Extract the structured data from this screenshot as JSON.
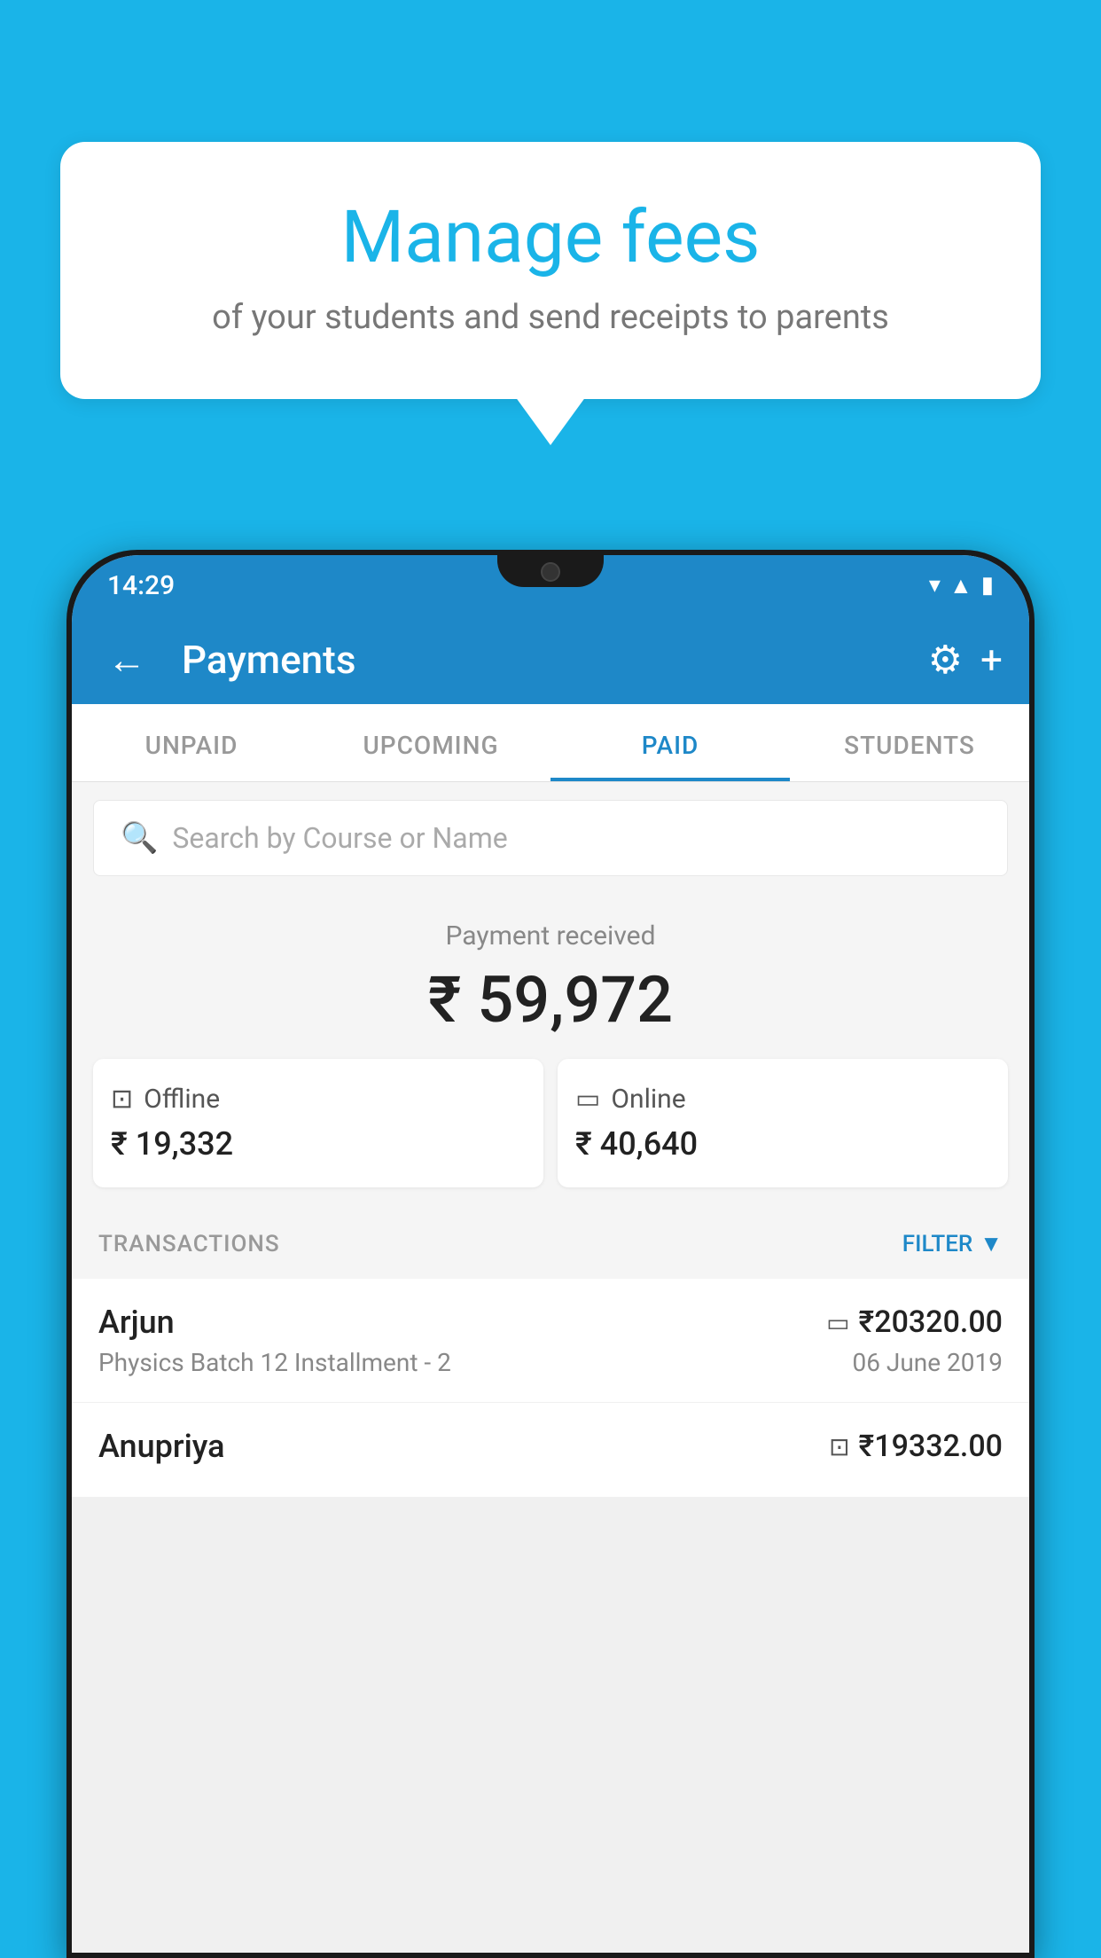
{
  "bubble": {
    "title": "Manage fees",
    "subtitle": "of your students and send receipts to parents"
  },
  "status_bar": {
    "time": "14:29"
  },
  "app_bar": {
    "title": "Payments",
    "back_label": "←",
    "gear_label": "⚙",
    "plus_label": "+"
  },
  "tabs": [
    {
      "label": "UNPAID",
      "active": false
    },
    {
      "label": "UPCOMING",
      "active": false
    },
    {
      "label": "PAID",
      "active": true
    },
    {
      "label": "STUDENTS",
      "active": false
    }
  ],
  "search": {
    "placeholder": "Search by Course or Name"
  },
  "payment_summary": {
    "label": "Payment received",
    "amount": "₹ 59,972",
    "offline": {
      "type": "Offline",
      "amount": "₹ 19,332"
    },
    "online": {
      "type": "Online",
      "amount": "₹ 40,640"
    }
  },
  "transactions": {
    "label": "TRANSACTIONS",
    "filter_label": "FILTER",
    "rows": [
      {
        "name": "Arjun",
        "course": "Physics Batch 12 Installment - 2",
        "amount": "₹20320.00",
        "date": "06 June 2019",
        "payment_type": "online"
      },
      {
        "name": "Anupriya",
        "course": "",
        "amount": "₹19332.00",
        "date": "",
        "payment_type": "offline"
      }
    ]
  },
  "colors": {
    "primary": "#1e88c8",
    "background": "#1ab4e8",
    "text_dark": "#222222",
    "text_gray": "#888888"
  }
}
